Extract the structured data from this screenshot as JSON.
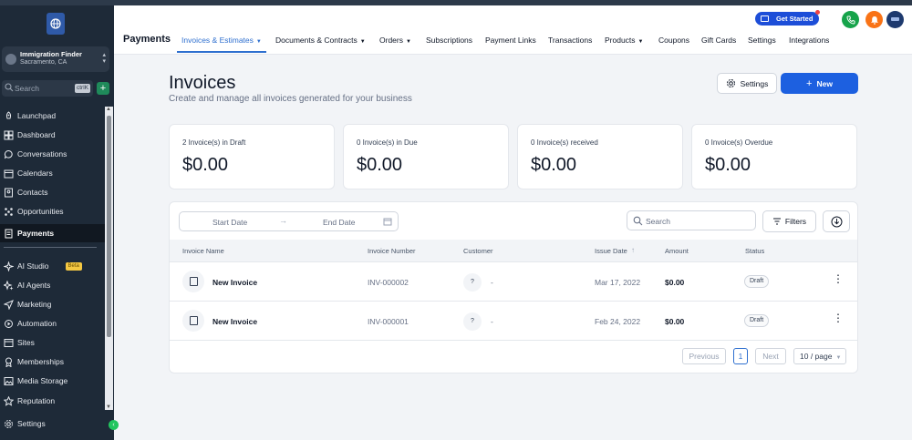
{
  "sidebar": {
    "account_name": "Immigration Finder",
    "account_location": "Sacramento, CA",
    "search_placeholder": "Search",
    "search_shortcut": "ctrlK",
    "items": [
      {
        "label": "Launchpad",
        "icon": "rocket-icon"
      },
      {
        "label": "Dashboard",
        "icon": "dashboard-icon"
      },
      {
        "label": "Conversations",
        "icon": "chat-icon"
      },
      {
        "label": "Calendars",
        "icon": "calendar-icon"
      },
      {
        "label": "Contacts",
        "icon": "contacts-icon"
      },
      {
        "label": "Opportunities",
        "icon": "opportunities-icon"
      },
      {
        "label": "Payments",
        "icon": "payments-icon",
        "active": true
      }
    ],
    "items2": [
      {
        "label": "AI Studio",
        "icon": "ai-studio-icon",
        "badge": "Beta"
      },
      {
        "label": "AI Agents",
        "icon": "ai-agents-icon"
      },
      {
        "label": "Marketing",
        "icon": "marketing-icon"
      },
      {
        "label": "Automation",
        "icon": "automation-icon"
      },
      {
        "label": "Sites",
        "icon": "sites-icon"
      },
      {
        "label": "Memberships",
        "icon": "memberships-icon"
      },
      {
        "label": "Media Storage",
        "icon": "media-icon"
      },
      {
        "label": "Reputation",
        "icon": "star-icon"
      }
    ],
    "settings_label": "Settings"
  },
  "header": {
    "title": "Payments",
    "tabs": [
      {
        "label": "Invoices & Estimates",
        "chevron": true,
        "active": true
      },
      {
        "label": "Documents & Contracts",
        "chevron": true
      },
      {
        "label": "Orders",
        "chevron": true
      },
      {
        "label": "Subscriptions"
      },
      {
        "label": "Payment Links"
      },
      {
        "label": "Transactions"
      },
      {
        "label": "Products",
        "chevron": true
      },
      {
        "label": "Coupons"
      },
      {
        "label": "Gift Cards"
      },
      {
        "label": "Settings"
      },
      {
        "label": "Integrations"
      }
    ],
    "get_started": "Get Started"
  },
  "main": {
    "title": "Invoices",
    "subtitle": "Create and manage all invoices generated for your business",
    "settings_button": "Settings",
    "new_button": "New",
    "stats": [
      {
        "label": "2 Invoice(s) in Draft",
        "value": "$0.00"
      },
      {
        "label": "0 Invoice(s) in Due",
        "value": "$0.00"
      },
      {
        "label": "0 Invoice(s) received",
        "value": "$0.00"
      },
      {
        "label": "0 Invoice(s) Overdue",
        "value": "$0.00"
      }
    ],
    "filters": {
      "start_date": "Start Date",
      "end_date": "End Date",
      "search_placeholder": "Search",
      "filters_button": "Filters"
    },
    "columns": [
      "Invoice Name",
      "Invoice Number",
      "Customer",
      "Issue Date",
      "Amount",
      "Status"
    ],
    "rows": [
      {
        "name": "New Invoice",
        "number": "INV-000002",
        "customer_initial": "?",
        "customer": "-",
        "date": "Mar 17, 2022",
        "amount": "$0.00",
        "status": "Draft"
      },
      {
        "name": "New Invoice",
        "number": "INV-000001",
        "customer_initial": "?",
        "customer": "-",
        "date": "Feb 24, 2022",
        "amount": "$0.00",
        "status": "Draft"
      }
    ],
    "pagination": {
      "previous": "Previous",
      "current": "1",
      "next": "Next",
      "per_page": "10 / page"
    }
  },
  "colors": {
    "accent": "#2e6fcf",
    "primary_button": "#1d60e0",
    "sidebar_bg": "#1e2a38"
  }
}
